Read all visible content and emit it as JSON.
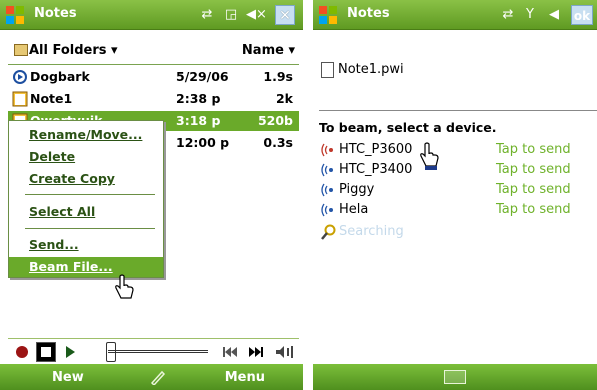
{
  "left": {
    "title": "Notes",
    "toolbar": {
      "folder_label": "All Folders ▾",
      "sort_label": "Name ▾"
    },
    "files": [
      {
        "name": "Dogbark",
        "date": "5/29/06",
        "size": "1.9s",
        "icon": "recording-icon",
        "selected": false
      },
      {
        "name": "Note1",
        "date": "2:38 p",
        "size": "2k",
        "icon": "note-icon",
        "selected": false
      },
      {
        "name": "Qwertyuik",
        "date": "3:18 p",
        "size": "520b",
        "icon": "note-icon",
        "selected": true
      },
      {
        "name": "",
        "date": "12:00 p",
        "size": "0.3s",
        "icon": "recording-icon",
        "selected": false
      }
    ],
    "context_menu": [
      {
        "label": "Rename/Move..."
      },
      {
        "label": "Delete"
      },
      {
        "label": "Create Copy"
      },
      {
        "label": "Select All"
      },
      {
        "label": "Send..."
      },
      {
        "label": "Beam File..."
      }
    ],
    "softkeys": {
      "left": "New",
      "right": "Menu"
    }
  },
  "right": {
    "title": "Notes",
    "ok_label": "ok",
    "document": "Note1.pwi",
    "beam_header": "To beam, select a device.",
    "devices": [
      {
        "name": "HTC_P3600",
        "action": "Tap to send"
      },
      {
        "name": "HTC_P3400",
        "action": "Tap to send"
      },
      {
        "name": "Piggy",
        "action": "Tap to send"
      },
      {
        "name": "Hela",
        "action": "Tap to send"
      }
    ],
    "searching": "Searching"
  },
  "colors": {
    "title_green": "#5f9a22",
    "selection_green": "#6aaa2a",
    "tap_green": "#6fb22b"
  }
}
